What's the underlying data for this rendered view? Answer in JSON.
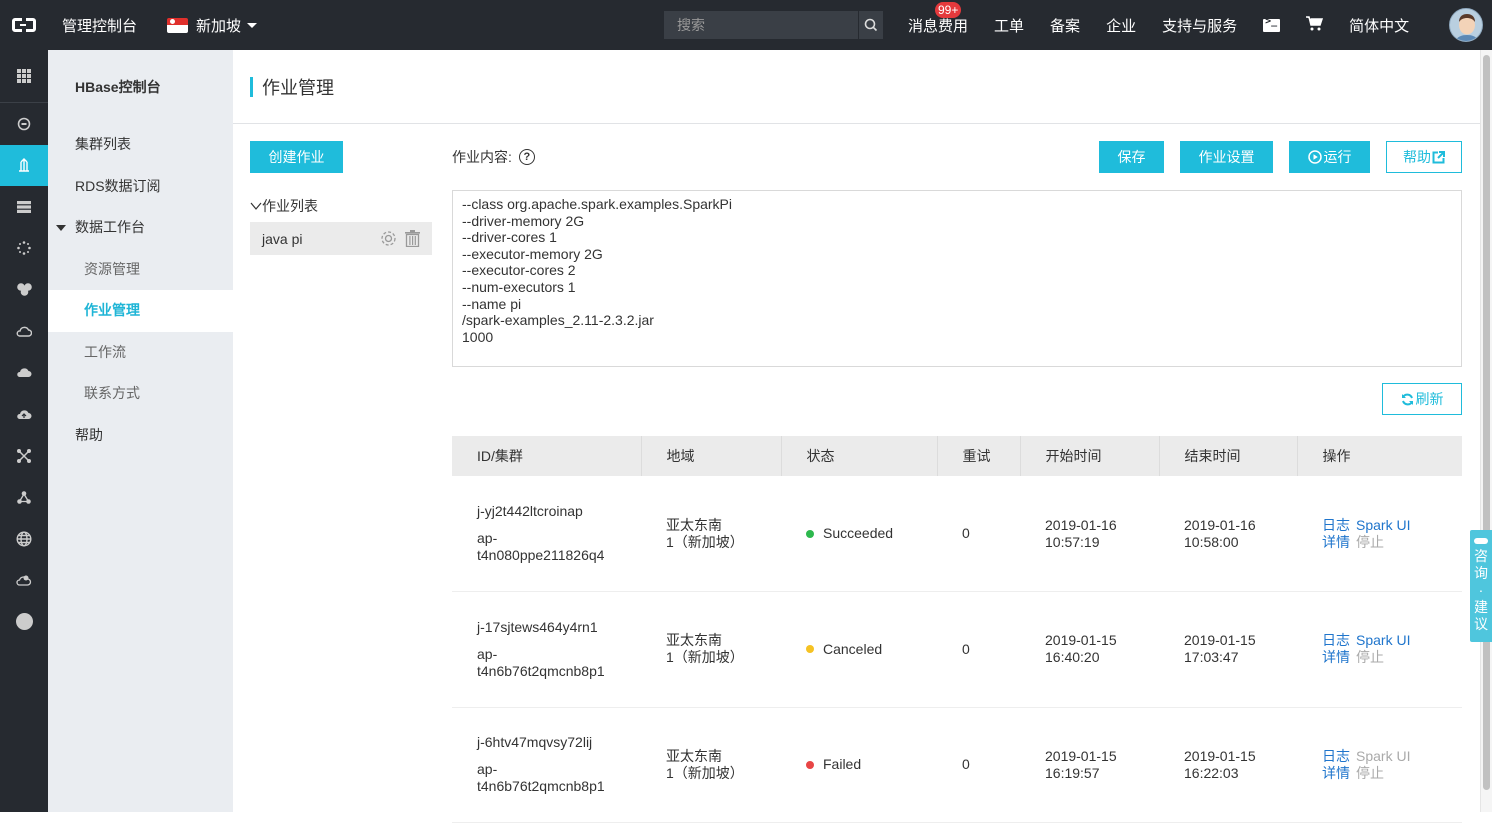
{
  "topbar": {
    "console_label": "管理控制台",
    "region": "新加坡",
    "search_placeholder": "搜索",
    "nav": [
      {
        "label": "消息",
        "badge": "99+"
      },
      {
        "label": "费用"
      },
      {
        "label": "工单"
      },
      {
        "label": "备案"
      },
      {
        "label": "企业"
      },
      {
        "label": "支持与服务"
      }
    ],
    "language": "简体中文"
  },
  "rail": {
    "icons": [
      "apps-grid-icon",
      "search-chat-icon",
      "hbase-icon",
      "server-icon",
      "dots-ring-icon",
      "cluster-icon",
      "cloud-outline-icon",
      "cloud-network-icon",
      "cloud-upload-icon",
      "network-cross-icon",
      "nodes-icon",
      "globe-icon",
      "cloud-gear-icon",
      "circle-icon"
    ],
    "active_index": 2
  },
  "sidebar": {
    "title": "HBase控制台",
    "items": [
      {
        "label": "集群列表"
      },
      {
        "label": "RDS数据订阅"
      },
      {
        "label": "数据工作台",
        "expanded": true
      },
      {
        "label": "资源管理",
        "sub": true
      },
      {
        "label": "作业管理",
        "sub": true,
        "active": true
      },
      {
        "label": "工作流",
        "sub": true
      },
      {
        "label": "联系方式",
        "sub": true
      },
      {
        "label": "帮助"
      }
    ]
  },
  "page": {
    "title": "作业管理",
    "create_button": "创建作业",
    "job_list_title": "作业列表",
    "jobs": [
      {
        "name": "java pi"
      }
    ],
    "content_label": "作业内容:",
    "buttons": {
      "save": "保存",
      "settings": "作业设置",
      "run": "运行",
      "help": "帮助",
      "refresh": "刷新"
    },
    "editor_content": "--class org.apache.spark.examples.SparkPi\n--driver-memory 2G\n--driver-cores 1\n--executor-memory 2G\n--executor-cores 2\n--num-executors 1\n--name pi\n/spark-examples_2.11-2.3.2.jar\n1000"
  },
  "table": {
    "headers": [
      "ID/集群",
      "地域",
      "状态",
      "重试",
      "开始时间",
      "结束时间",
      "操作"
    ],
    "rows": [
      {
        "id": "j-yj2t442ltcroinap",
        "cluster_a": "ap-",
        "cluster_b": "t4n080ppe211826q4",
        "region_a": "亚太东南",
        "region_b": "1（新加坡）",
        "status": "Succeeded",
        "status_color": "#2db84d",
        "retry": "0",
        "start_date": "2019-01-16",
        "start_time": "10:57:19",
        "end_date": "2019-01-16",
        "end_time": "10:58:00",
        "ops": {
          "log": "日志",
          "spark_ui": "Spark UI",
          "spark_ui_enabled": true,
          "detail": "详情",
          "stop": "停止"
        }
      },
      {
        "id": "j-17sjtews464y4rn1",
        "cluster_a": "ap-",
        "cluster_b": "t4n6b76t2qmcnb8p1",
        "region_a": "亚太东南",
        "region_b": "1（新加坡）",
        "status": "Canceled",
        "status_color": "#f5c223",
        "retry": "0",
        "start_date": "2019-01-15",
        "start_time": "16:40:20",
        "end_date": "2019-01-15",
        "end_time": "17:03:47",
        "ops": {
          "log": "日志",
          "spark_ui": "Spark UI",
          "spark_ui_enabled": true,
          "detail": "详情",
          "stop": "停止"
        }
      },
      {
        "id": "j-6htv47mqvsy72lij",
        "cluster_a": "ap-",
        "cluster_b": "t4n6b76t2qmcnb8p1",
        "region_a": "亚太东南",
        "region_b": "1（新加坡）",
        "status": "Failed",
        "status_color": "#e84545",
        "retry": "0",
        "start_date": "2019-01-15",
        "start_time": "16:19:57",
        "end_date": "2019-01-15",
        "end_time": "16:22:03",
        "ops": {
          "log": "日志",
          "spark_ui": "Spark UI",
          "spark_ui_enabled": false,
          "detail": "详情",
          "stop": "停止"
        }
      }
    ]
  },
  "feedback": [
    "咨",
    "询",
    "·",
    "建",
    "议"
  ],
  "colors": {
    "accent": "#1fbcdb",
    "topbar": "#262a30",
    "link": "#1f75cc"
  }
}
